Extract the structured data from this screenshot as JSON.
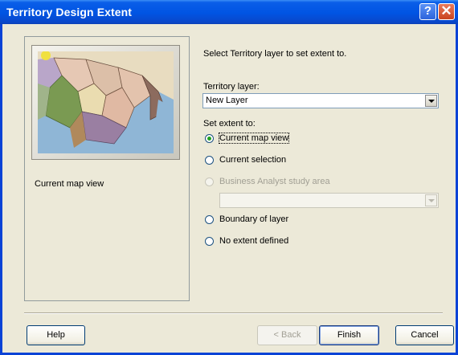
{
  "window": {
    "title": "Territory Design Extent",
    "help_glyph": "?",
    "close_glyph": "✕"
  },
  "left_panel": {
    "caption": "Current map view"
  },
  "form": {
    "instruction": "Select Territory layer to set extent to.",
    "territory_layer_label": "Territory layer:",
    "territory_layer_value": "New Layer",
    "extent_label": "Set extent to:",
    "options": [
      {
        "label": "Current map view",
        "checked": true,
        "enabled": true
      },
      {
        "label": "Current selection",
        "checked": false,
        "enabled": true
      },
      {
        "label": "Business Analyst study area",
        "checked": false,
        "enabled": false
      },
      {
        "label": "Boundary of layer",
        "checked": false,
        "enabled": true
      },
      {
        "label": "No extent defined",
        "checked": false,
        "enabled": true
      }
    ],
    "study_area_value": ""
  },
  "buttons": {
    "help": "Help",
    "back": "< Back",
    "finish": "Finish",
    "cancel": "Cancel"
  },
  "colors": {
    "titlebar": "#0054e3",
    "dialog_bg": "#ece9d8",
    "radio_dot": "#21a121"
  }
}
